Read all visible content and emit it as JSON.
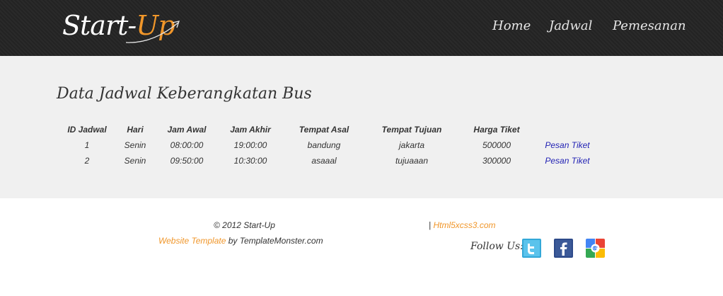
{
  "header": {
    "logo_prefix": "Start-",
    "logo_suffix": "Up",
    "nav": [
      "Home",
      "Jadwal",
      "Pemesanan"
    ]
  },
  "main": {
    "title": "Data Jadwal Keberangkatan Bus",
    "columns": [
      "ID Jadwal",
      "Hari",
      "Jam Awal",
      "Jam Akhir",
      "Tempat Asal",
      "Tempat Tujuan",
      "Harga Tiket",
      ""
    ],
    "rows": [
      [
        "1",
        "Senin",
        "08:00:00",
        "19:00:00",
        "bandung",
        "jakarta",
        "500000",
        "Pesan Tiket"
      ],
      [
        "2",
        "Senin",
        "09:50:00",
        "10:30:00",
        "asaaal",
        "tujuaaan",
        "300000",
        "Pesan Tiket"
      ]
    ]
  },
  "footer": {
    "copyright": "© 2012 Start-Up",
    "separator": "|",
    "site_link": "Html5xcss3.com",
    "template_link": "Website Template",
    "by_text": " by TemplateMonster.com",
    "follow_label": "Follow Us:",
    "social": [
      "twitter-icon",
      "facebook-icon",
      "google-icon"
    ]
  },
  "colors": {
    "accent": "#f0962a",
    "header_bg": "#282828",
    "main_bg": "#f0f0f0",
    "link": "#2323b4"
  }
}
